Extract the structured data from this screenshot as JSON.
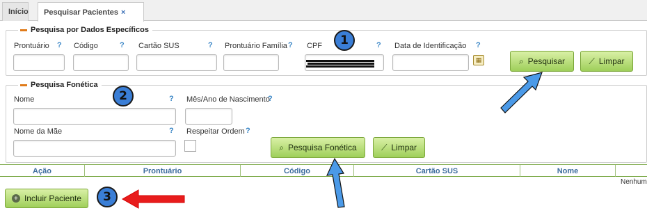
{
  "tabs": {
    "inicio": "Início",
    "active": "Pesquisar Pacientes",
    "close": "×"
  },
  "specific": {
    "legend": "Pesquisa por Dados Específicos",
    "prontuario": "Prontuário",
    "codigo": "Código",
    "cartao_sus": "Cartão SUS",
    "prontuario_familia": "Prontuário Família",
    "cpf": "CPF",
    "data_identificacao": "Data de Identificação",
    "search_button": "Pesquisar",
    "clear_button": "Limpar"
  },
  "phonetic": {
    "legend": "Pesquisa Fonética",
    "nome": "Nome",
    "mes_ano": "Mês/Ano de Nascimento",
    "nome_mae": "Nome da Mãe",
    "respeitar_ordem": "Respeitar Ordem",
    "search_button": "Pesquisa Fonética",
    "clear_button": "Limpar"
  },
  "help_mark": "?",
  "table": {
    "columns": [
      "Ação",
      "Prontuário",
      "Código",
      "Cartão SUS",
      "Nome"
    ],
    "empty_text": "Nenhum"
  },
  "include_button": "Incluir Paciente",
  "annotations": [
    "1",
    "2",
    "3"
  ],
  "colors": {
    "accent_orange": "#e07b1a",
    "button_green": "#9fcf5a",
    "help_blue": "#3a86c6",
    "badge_blue": "#3a7ed6",
    "arrow_red": "#e81c1c"
  },
  "icons": {
    "search": "magnifier-icon",
    "clear": "broom-icon",
    "calendar": "calendar-icon",
    "include": "plus-circle-icon"
  }
}
